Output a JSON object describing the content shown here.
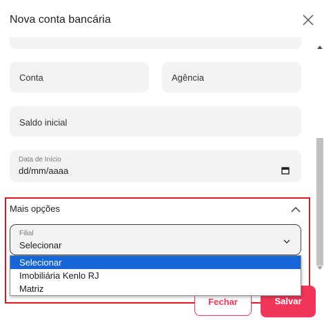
{
  "dialog": {
    "title": "Nova conta bancária"
  },
  "form": {
    "conta_placeholder": "Conta",
    "agencia_placeholder": "Agência",
    "saldo_placeholder": "Saldo inicial",
    "data_label": "Data de Início",
    "data_value": "dd/mm/aaaa"
  },
  "more_options": {
    "label": "Mais opções",
    "filial_label": "Filial",
    "filial_value": "Selecionar",
    "options": [
      "Selecionar",
      "Imobiliária Kenlo RJ",
      "Matriz"
    ]
  },
  "footer": {
    "fechar_label": "Fechar",
    "salvar_label": "Salvar"
  },
  "icons": {
    "close": "close-icon",
    "calendar": "calendar-icon",
    "chevron_up": "chevron-up-icon",
    "chevron_down": "chevron-down-icon"
  },
  "colors": {
    "accent": "#f2365a",
    "highlight_border": "#e0141b",
    "selected_option": "#1565d8",
    "field_bg": "#f3f3f3"
  }
}
